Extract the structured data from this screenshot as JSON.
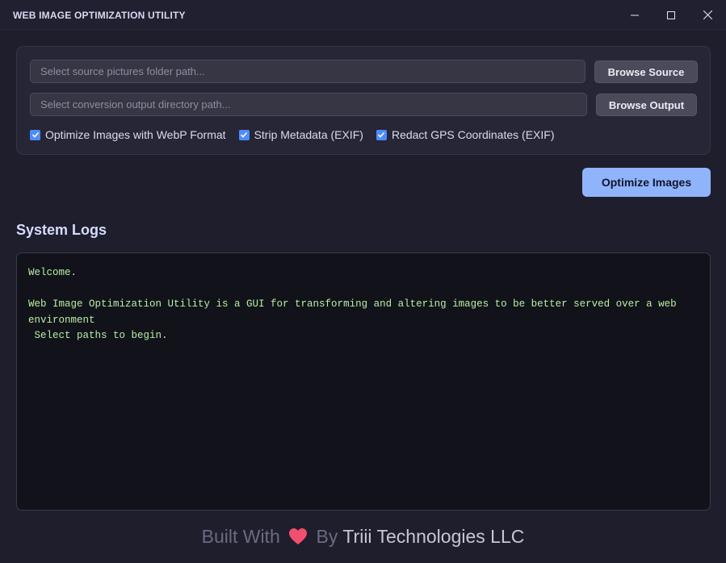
{
  "window": {
    "title": "WEB IMAGE OPTIMIZATION UTILITY",
    "controls": [
      "minimize-icon",
      "maximize-icon",
      "close-icon"
    ]
  },
  "inputs": {
    "source_placeholder": "Select source pictures folder path...",
    "source_value": "",
    "output_placeholder": "Select conversion output directory path...",
    "output_value": ""
  },
  "buttons": {
    "browse_source": "Browse Source",
    "browse_output": "Browse Output",
    "optimize": "Optimize Images"
  },
  "options": [
    {
      "label": "Optimize Images with WebP Format",
      "checked": true
    },
    {
      "label": "Strip Metadata (EXIF)",
      "checked": true
    },
    {
      "label": "Redact GPS Coordinates (EXIF)",
      "checked": true
    }
  ],
  "logs": {
    "title": "System Logs",
    "lines": [
      "Welcome.",
      "",
      "Web Image Optimization Utility is a GUI for transforming and altering images to be better served over a web environment",
      " Select paths to begin."
    ]
  },
  "footer": {
    "built_with": "Built With",
    "by": "By",
    "company": "Triii Technologies LLC",
    "icon": "heart-icon"
  },
  "colors": {
    "background": "#1e1e2d",
    "accent": "#8fb4fb",
    "checkbox": "#4d8bff",
    "log_text": "#b6f0a3",
    "heart": "#f0506e"
  }
}
